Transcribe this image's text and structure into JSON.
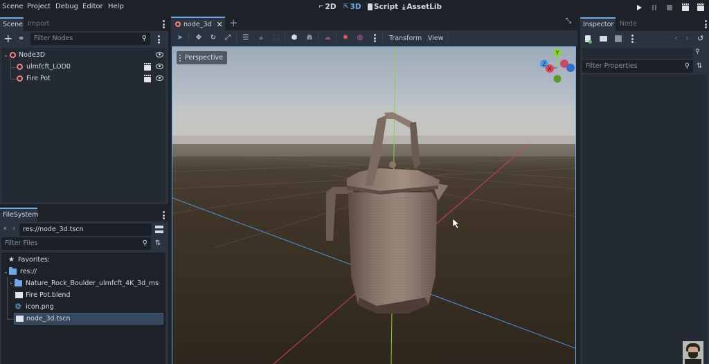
{
  "menubar": {
    "items": [
      "Scene",
      "Project",
      "Debug",
      "Editor",
      "Help"
    ],
    "workspaces": [
      {
        "label": "2D",
        "icon": "2d-icon",
        "active": false
      },
      {
        "label": "3D",
        "icon": "3d-icon",
        "active": true
      },
      {
        "label": "Script",
        "icon": "script-icon",
        "active": false
      },
      {
        "label": "AssetLib",
        "icon": "assetlib-icon",
        "active": false
      }
    ],
    "run_controls": [
      "play-icon",
      "pause-icon",
      "stop-icon",
      "play-scene-icon",
      "play-custom-scene-icon"
    ]
  },
  "scene_dock": {
    "tabs": [
      "Scene",
      "Import"
    ],
    "active_tab": "Scene",
    "filter_placeholder": "Filter Nodes",
    "tree": [
      {
        "name": "Node3D",
        "level": 0,
        "expanded": true,
        "has_clapper": false
      },
      {
        "name": "ulmfcft_LOD0",
        "level": 1,
        "has_clapper": true
      },
      {
        "name": "Fire Pot",
        "level": 1,
        "has_clapper": true
      }
    ]
  },
  "filesystem_dock": {
    "tab": "FileSystem",
    "path": "res://node_3d.tscn",
    "filter_placeholder": "Filter Files",
    "favorites_label": "Favorites:",
    "root": "res://",
    "items": [
      {
        "name": "Nature_Rock_Boulder_ulmfcft_4K_3d_ms",
        "type": "folder",
        "selected": false
      },
      {
        "name": "Fire Pot.blend",
        "type": "scene",
        "selected": false
      },
      {
        "name": "icon.png",
        "type": "image",
        "selected": false
      },
      {
        "name": "node_3d.tscn",
        "type": "scene",
        "selected": true
      }
    ]
  },
  "editor": {
    "scene_tab": "node_3d",
    "toolbar_menus": [
      "Transform",
      "View"
    ],
    "viewport_label": "Perspective",
    "gizmo_axes": [
      "X",
      "Y",
      "Z"
    ]
  },
  "inspector_dock": {
    "tabs": [
      "Inspector",
      "Node"
    ],
    "active_tab": "Inspector",
    "filter_placeholder": "Filter Properties"
  },
  "colors": {
    "accent": "#6fa9e8",
    "node3d": "#fc7f7f",
    "axis_x": "#e0435a",
    "axis_y": "#8cd43a",
    "axis_z": "#4a9be8"
  }
}
